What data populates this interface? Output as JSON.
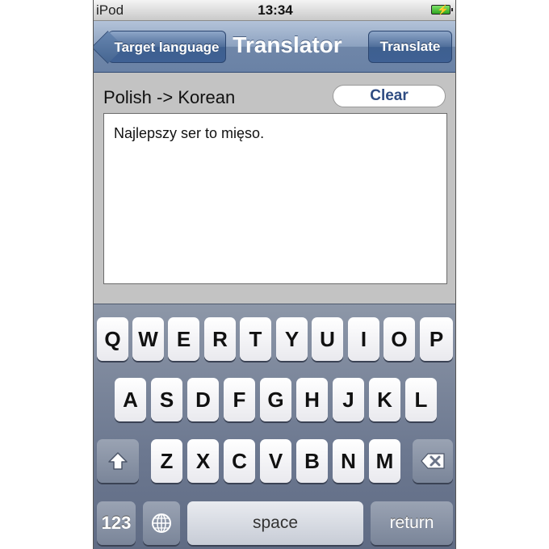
{
  "status_bar": {
    "carrier": "iPod",
    "time": "13:34"
  },
  "nav": {
    "back_label": "Target language",
    "title": "Translator",
    "action_label": "Translate"
  },
  "content": {
    "language_pair": "Polish -> Korean",
    "clear_label": "Clear",
    "input_text": "Najlepszy ser to mięso."
  },
  "keyboard": {
    "row1": [
      "Q",
      "W",
      "E",
      "R",
      "T",
      "Y",
      "U",
      "I",
      "O",
      "P"
    ],
    "row2": [
      "A",
      "S",
      "D",
      "F",
      "G",
      "H",
      "J",
      "K",
      "L"
    ],
    "row3": [
      "Z",
      "X",
      "C",
      "V",
      "B",
      "N",
      "M"
    ],
    "numbers_label": "123",
    "space_label": "space",
    "return_label": "return",
    "shift_icon": "shift-arrow-icon",
    "globe_icon": "globe-icon",
    "backspace_icon": "backspace-icon"
  }
}
